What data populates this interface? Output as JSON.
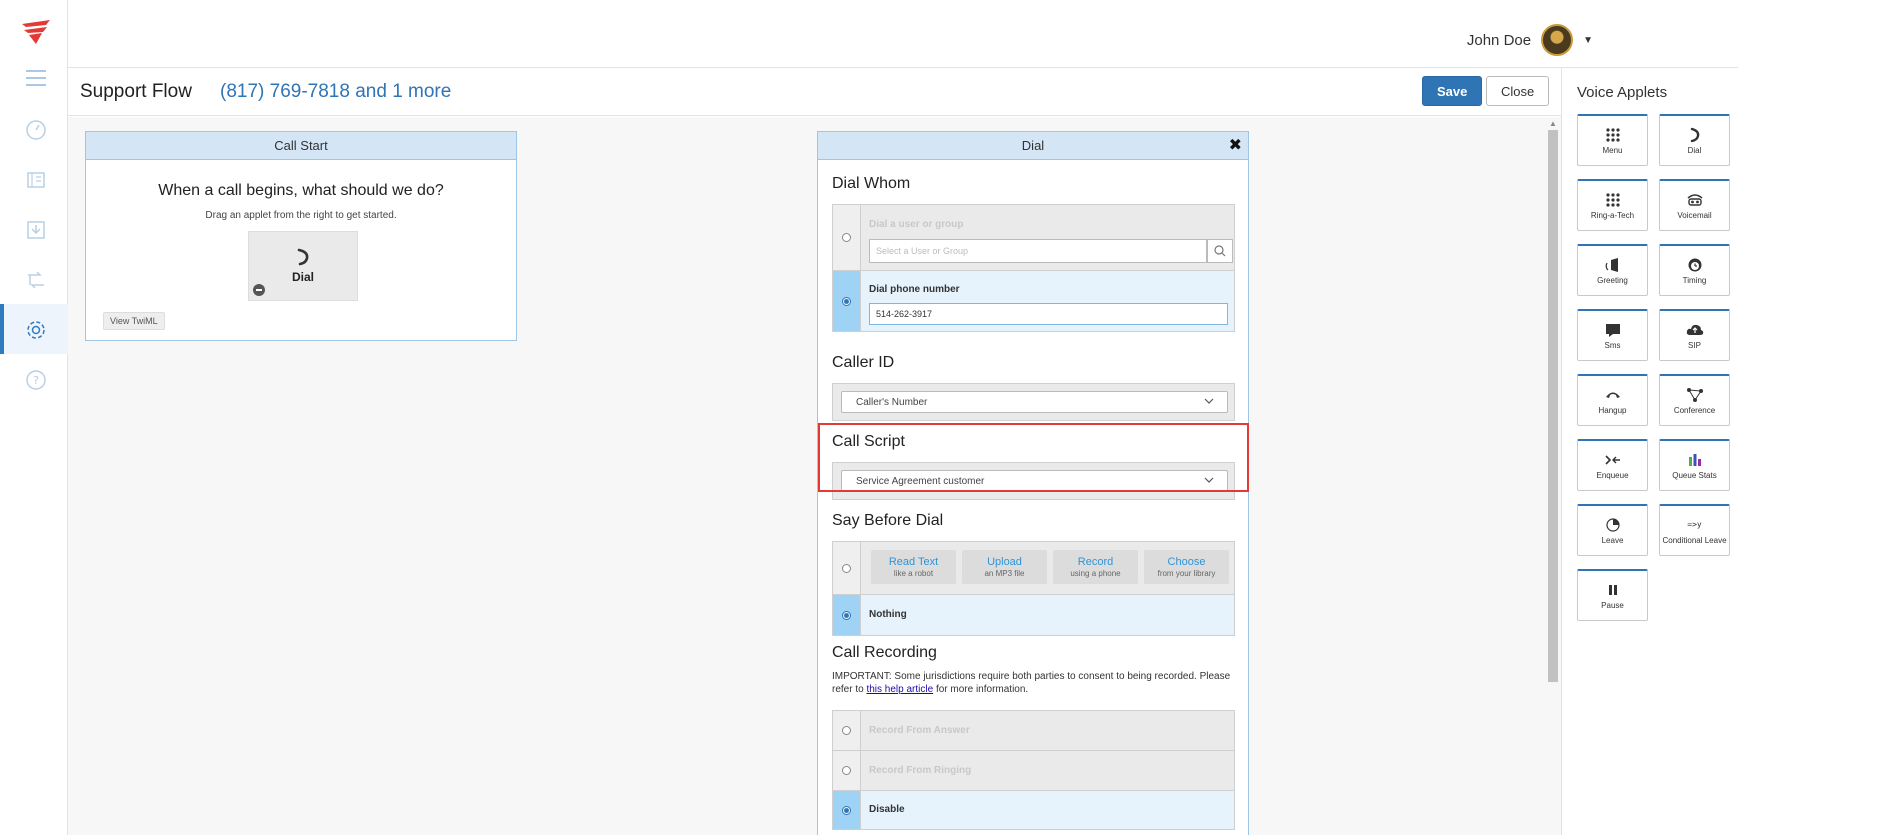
{
  "user": {
    "name": "John Doe"
  },
  "flow": {
    "title": "Support Flow",
    "numbers": "(817) 769-7818 and 1 more",
    "save_label": "Save",
    "close_label": "Close"
  },
  "call_start": {
    "header": "Call Start",
    "question": "When a call begins, what should we do?",
    "hint": "Drag an applet from the right to get started.",
    "dropped_applet": "Dial",
    "view_twiml": "View TwiML"
  },
  "dial": {
    "header": "Dial",
    "dial_whom": {
      "title": "Dial Whom",
      "user_group_label": "Dial a user or group",
      "user_group_placeholder": "Select a User or Group",
      "phone_label": "Dial phone number",
      "phone_value": "514-262-3917"
    },
    "caller_id": {
      "title": "Caller ID",
      "value": "Caller's Number"
    },
    "call_script": {
      "title": "Call Script",
      "value": "Service Agreement customer"
    },
    "say_before": {
      "title": "Say Before Dial",
      "options": [
        {
          "title": "Read Text",
          "sub": "like a robot"
        },
        {
          "title": "Upload",
          "sub": "an MP3 file"
        },
        {
          "title": "Record",
          "sub": "using a phone"
        },
        {
          "title": "Choose",
          "sub": "from your library"
        }
      ],
      "nothing_label": "Nothing"
    },
    "recording": {
      "title": "Call Recording",
      "important_pre": "IMPORTANT: Some jurisdictions require both parties to consent to being recorded. Please refer to ",
      "link": "this help article",
      "important_post": " for more information.",
      "opt_answer": "Record From Answer",
      "opt_ringing": "Record From Ringing",
      "opt_disable": "Disable"
    }
  },
  "applets": {
    "title": "Voice Applets",
    "items": [
      "Menu",
      "Dial",
      "Ring-a-Tech",
      "Voicemail",
      "Greeting",
      "Timing",
      "Sms",
      "SIP",
      "Hangup",
      "Conference",
      "Enqueue",
      "Queue Stats",
      "Leave",
      "Conditional Leave",
      "Pause"
    ],
    "leave_glyph": "=>y"
  }
}
